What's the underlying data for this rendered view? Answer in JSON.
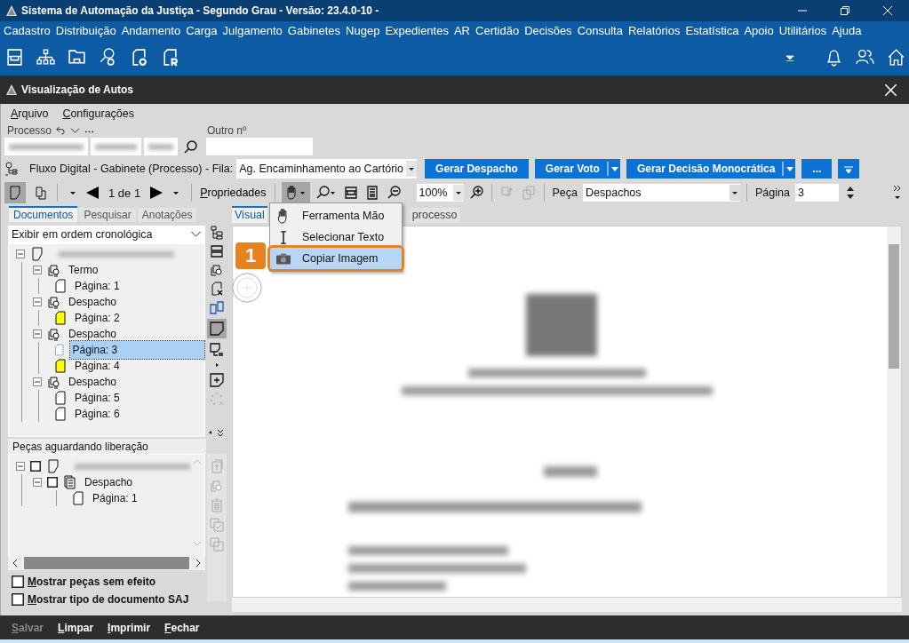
{
  "window": {
    "title": "Sistema de Automação da Justiça - Segundo Grau - Versão: 23.4.0-10 -"
  },
  "menu": [
    "Cadastro",
    "Distribuição",
    "Andamento",
    "Carga",
    "Julgamento",
    "Gabinetes",
    "Nugep",
    "Expedientes",
    "AR",
    "Certidão",
    "Decisões",
    "Consulta",
    "Relatórios",
    "Estatística",
    "Apoio",
    "Utilitários",
    "Ajuda"
  ],
  "subwindow": {
    "title": "Visualização de Autos"
  },
  "submenu": [
    "Arquivo",
    "Configurações"
  ],
  "process": {
    "label": "Processo",
    "other_label": "Outro nº"
  },
  "flow": {
    "text": "Fluxo Digital - Gabinete (Processo) - Fila:",
    "queue": "Ag. Encaminhamento ao Cartório"
  },
  "actions": [
    {
      "label": "Gerar Despacho",
      "dropdown": false
    },
    {
      "label": "Gerar Voto",
      "dropdown": true
    },
    {
      "label": "Gerar Decisão Monocrática",
      "dropdown": true
    },
    {
      "label": "...",
      "dropdown": false
    }
  ],
  "toolbar": {
    "pages": "1 de 1",
    "properties": "Propriedades",
    "zoom": "100%",
    "piece_label": "Peça",
    "piece": "Despachos",
    "page_label": "Página",
    "page": "3"
  },
  "left_tabs": [
    {
      "label": "Documentos",
      "selected": true
    },
    {
      "label": "Pesquisar",
      "selected": false
    },
    {
      "label": "Anotações",
      "selected": false
    }
  ],
  "order": "Exibir em ordem cronológica",
  "tree": {
    "expanded": true,
    "children": [
      {
        "label": "Termo",
        "expanded": true,
        "children": [
          {
            "label": "Página: 1",
            "selected": false,
            "flagged": false
          }
        ]
      },
      {
        "label": "Despacho",
        "expanded": true,
        "children": [
          {
            "label": "Página: 2",
            "selected": false,
            "flagged": true
          }
        ]
      },
      {
        "label": "Despacho",
        "expanded": true,
        "children": [
          {
            "label": "Página: 3",
            "selected": true,
            "flagged": false
          },
          {
            "label": "Página: 4",
            "selected": false,
            "flagged": true
          }
        ]
      },
      {
        "label": "Despacho",
        "expanded": true,
        "children": [
          {
            "label": "Página: 5",
            "selected": false,
            "flagged": false
          },
          {
            "label": "Página: 6",
            "selected": false,
            "flagged": false
          }
        ]
      }
    ]
  },
  "pending": {
    "title": "Peças aguardando liberação",
    "checked": false,
    "children": [
      {
        "label": "Despacho",
        "checked": false,
        "children": [
          {
            "label": "Página: 1"
          }
        ]
      }
    ]
  },
  "options": [
    {
      "label": "Mostrar peças sem efeito",
      "checked": false
    },
    {
      "label": "Mostrar tipo de documento SAJ",
      "checked": false
    }
  ],
  "viewer_tabs": [
    {
      "label": "Visual",
      "selected": true
    },
    {
      "label": "processo",
      "selected": false
    }
  ],
  "context_menu": [
    {
      "label": "Ferramenta Mão",
      "selected": false,
      "kind": "hand"
    },
    {
      "label": "Selecionar Texto",
      "selected": false,
      "kind": "text"
    },
    {
      "label": "Copiar Imagem",
      "selected": true,
      "kind": "camera"
    }
  ],
  "callout": "1",
  "footer": [
    {
      "label": "Salvar",
      "disabled": true
    },
    {
      "label": "Limpar",
      "disabled": false
    },
    {
      "label": "Imprimir",
      "disabled": false
    },
    {
      "label": "Fechar",
      "disabled": false
    }
  ]
}
